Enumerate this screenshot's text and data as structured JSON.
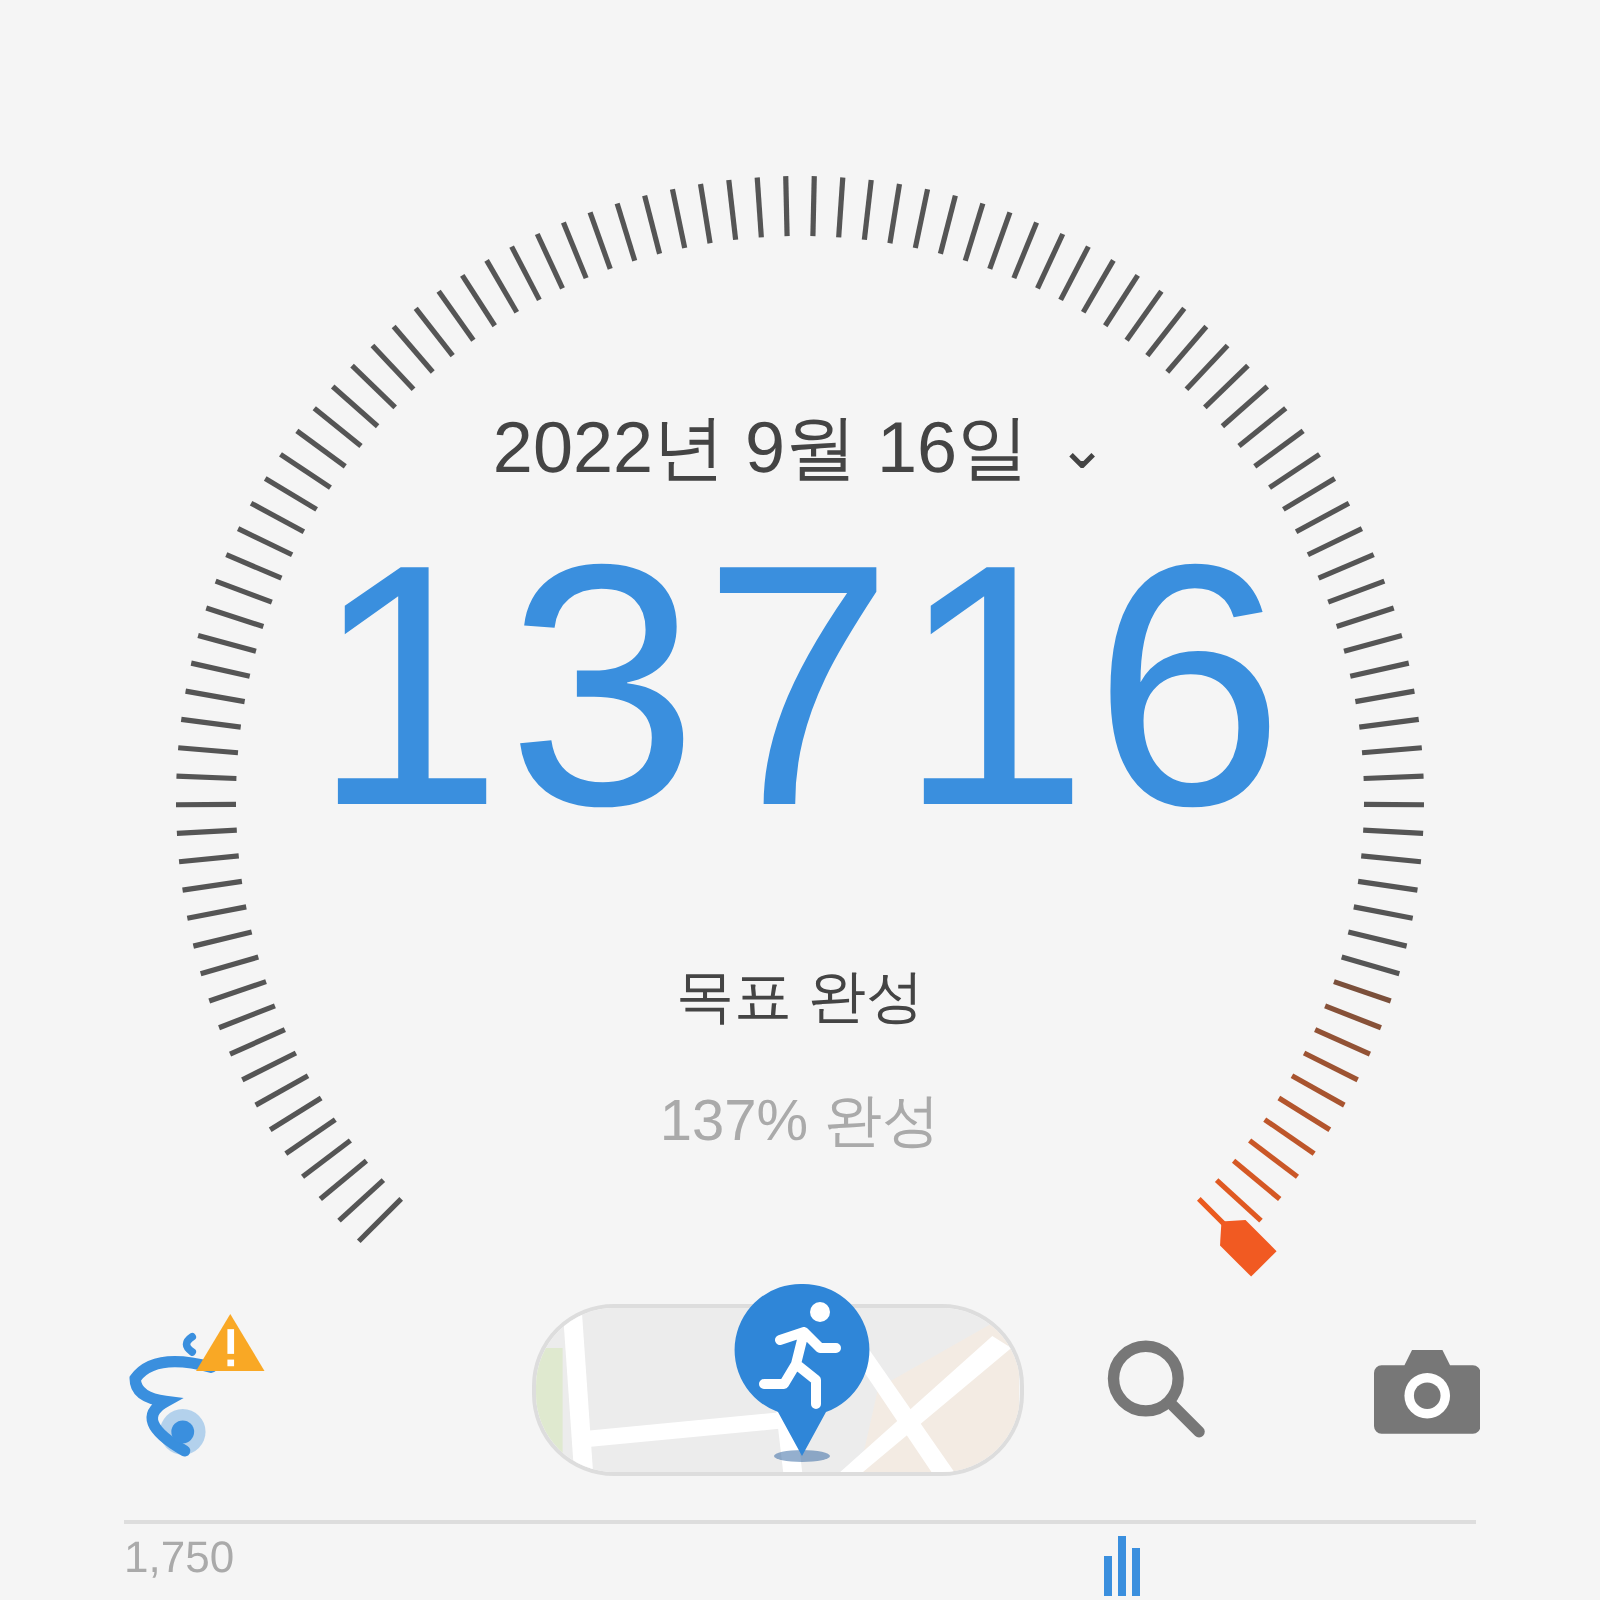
{
  "date": {
    "label": "2022년 9월 16일",
    "expand_icon": "⌄"
  },
  "steps": "13716",
  "goal": {
    "status": "목표 완성",
    "percent": "137% 완성"
  },
  "toolbar": {
    "warning": true
  },
  "chart": {
    "top_label": "1,750"
  }
}
